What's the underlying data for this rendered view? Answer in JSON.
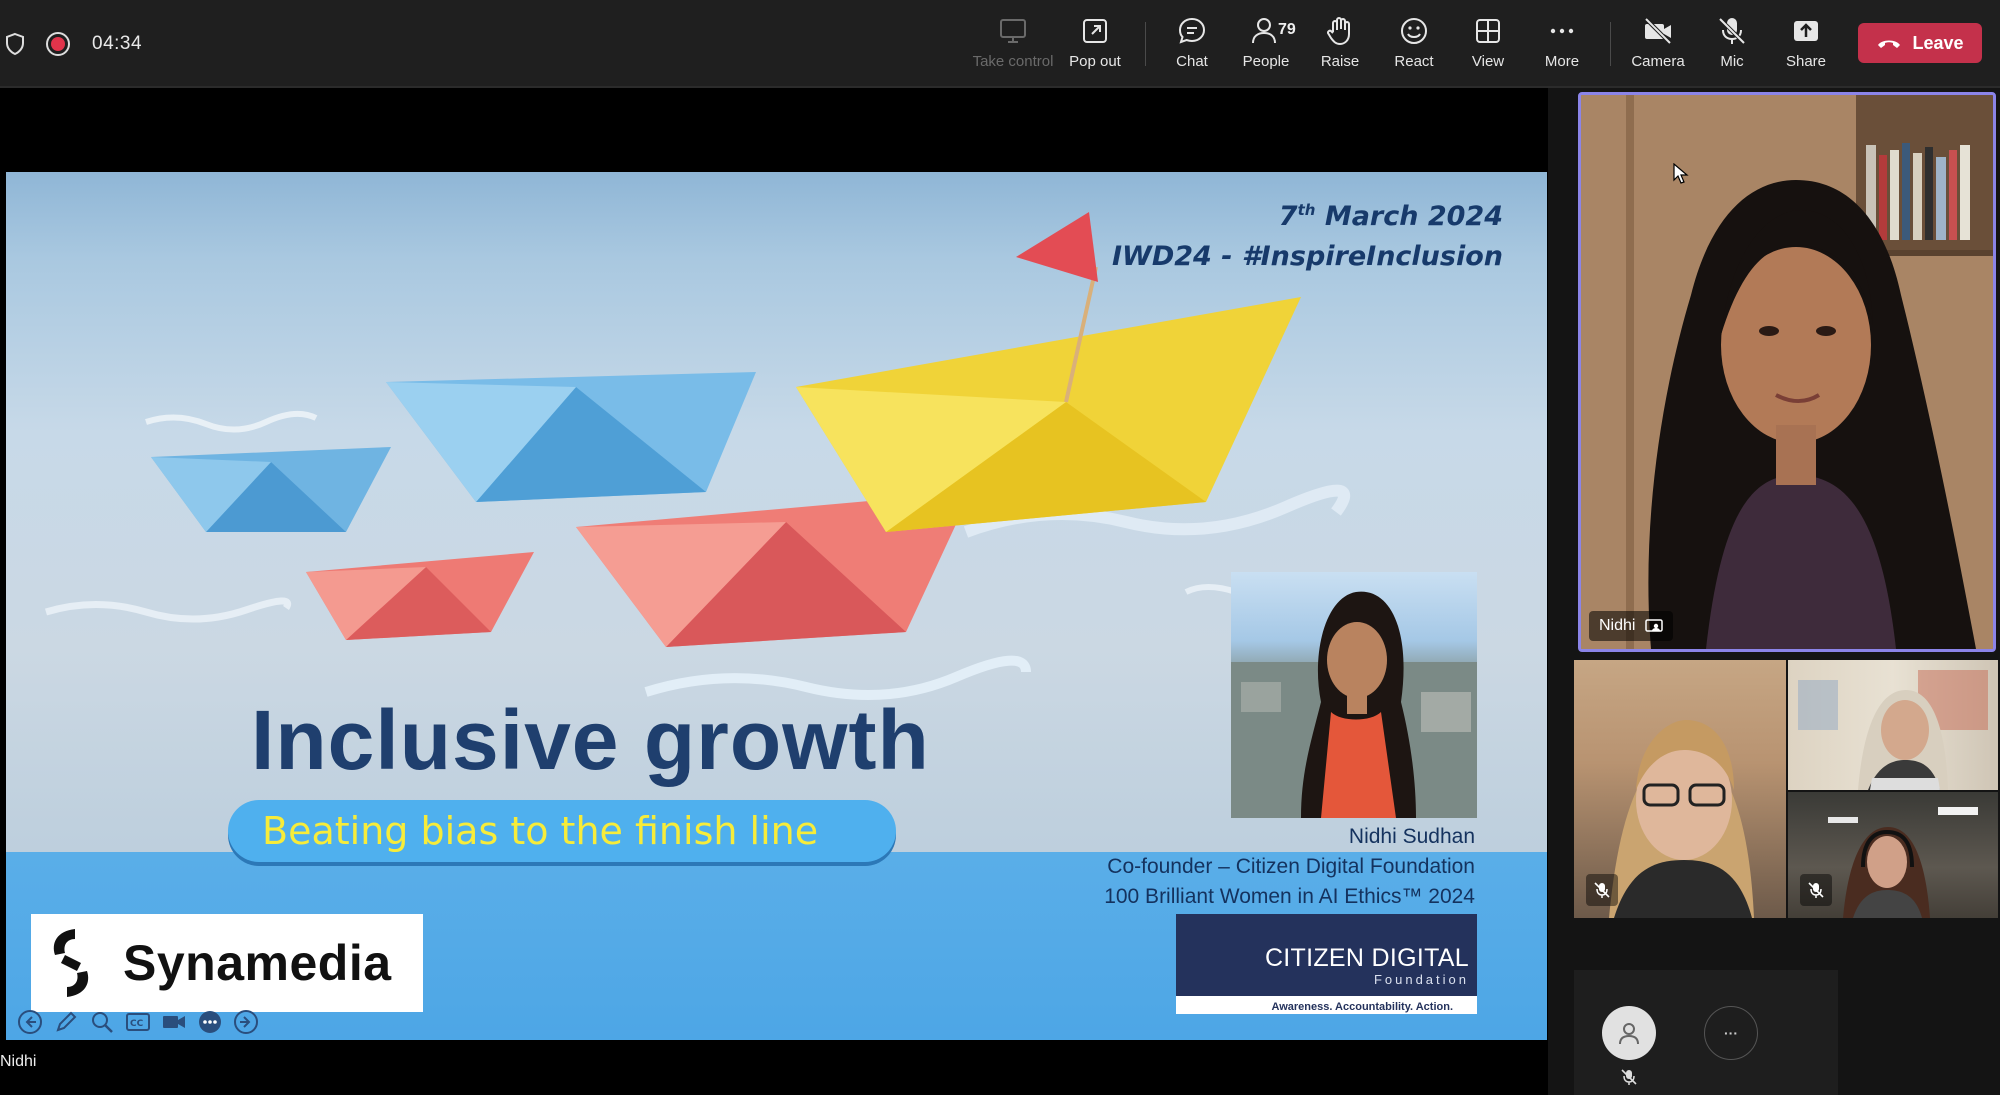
{
  "toolbar": {
    "timer": "04:34",
    "buttons": {
      "take_control": "Take control",
      "pop_out": "Pop out",
      "chat": "Chat",
      "people": "People",
      "people_count": "79",
      "raise": "Raise",
      "react": "React",
      "view": "View",
      "more": "More",
      "camera": "Camera",
      "mic": "Mic",
      "share": "Share"
    },
    "leave": "Leave",
    "colors": {
      "leave": "#c4314b",
      "recording": "#e0344b",
      "active_speaker_border": "#8b84e8"
    }
  },
  "slide": {
    "date_day": "7",
    "date_suffix": "th",
    "date_rest": " March 2024",
    "event": "IWD24 - #InspireInclusion",
    "title": "Inclusive growth",
    "subtitle": "Beating bias to the finish line",
    "speaker_name": "Nidhi Sudhan",
    "speaker_role": "Co-founder – Citizen Digital Foundation",
    "speaker_award": "100 Brilliant Women in AI Ethics™ 2024",
    "logo_left": "Synamedia",
    "logo_right_line1": "CITIZEN DIGITAL",
    "logo_right_line2": "Foundation",
    "logo_right_tagline": "Awareness. Accountability. Action."
  },
  "stage": {
    "presenter_label": "Nidhi"
  },
  "gallery": {
    "main_tile_name": "Nidhi",
    "overflow_more": "···"
  }
}
